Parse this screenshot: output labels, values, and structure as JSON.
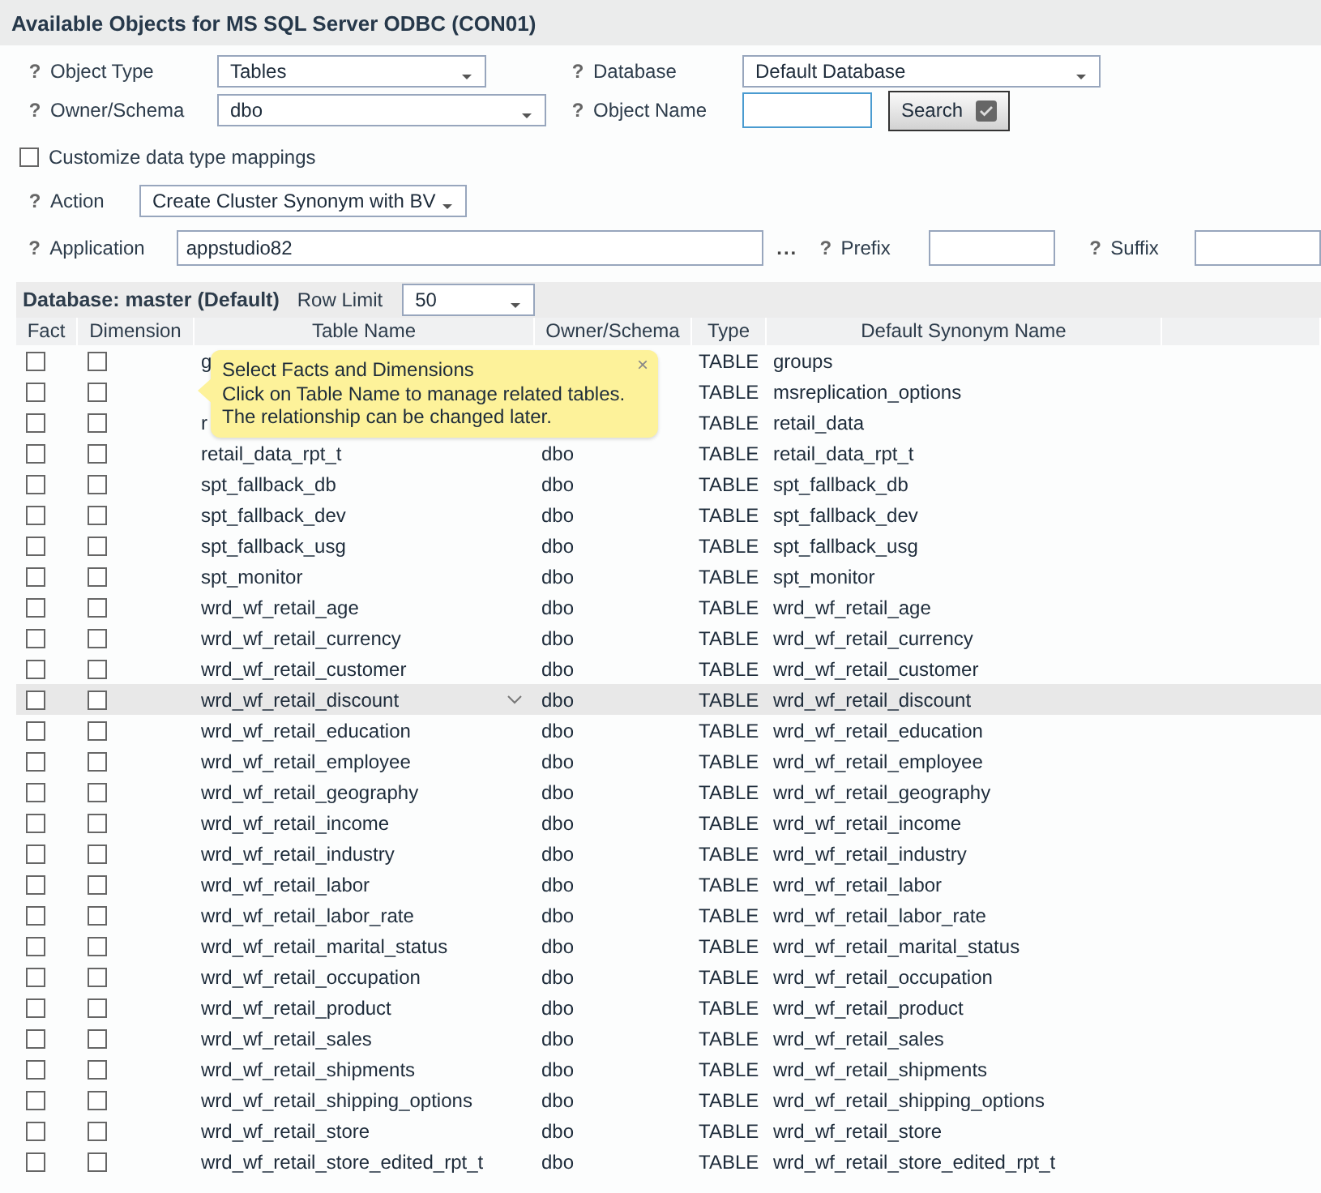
{
  "title": "Available Objects for MS SQL Server ODBC (CON01)",
  "form": {
    "object_type": {
      "help": "?",
      "label": "Object Type",
      "value": "Tables"
    },
    "database": {
      "help": "?",
      "label": "Database",
      "value": "Default Database"
    },
    "owner_schema": {
      "help": "?",
      "label": "Owner/Schema",
      "value": "dbo"
    },
    "object_name": {
      "help": "?",
      "label": "Object Name"
    },
    "search_button": "Search",
    "customize": {
      "label": "Customize data type mappings",
      "checked": false
    },
    "action": {
      "help": "?",
      "label": "Action",
      "value": "Create Cluster Synonym with BV"
    },
    "application": {
      "help": "?",
      "label": "Application",
      "value": "appstudio82",
      "browse": "..."
    },
    "prefix": {
      "help": "?",
      "label": "Prefix"
    },
    "suffix": {
      "help": "?",
      "label": "Suffix"
    }
  },
  "table": {
    "database_label": "Database: master (Default)",
    "row_limit": {
      "label": "Row Limit",
      "value": "50"
    },
    "columns": [
      "Fact",
      "Dimension",
      "Table Name",
      "Owner/Schema",
      "Type",
      "Default Synonym Name"
    ],
    "tooltip": {
      "lines": [
        "Select Facts and Dimensions",
        "Click on Table Name to manage related tables.",
        "The relationship can be changed later."
      ],
      "close": "×"
    },
    "rows": [
      {
        "fact": false,
        "dimension": false,
        "table_name": "g",
        "type": "TABLE",
        "synonym": "groups",
        "hovered": false
      },
      {
        "fact": false,
        "dimension": false,
        "type": "TABLE",
        "synonym": "msreplication_options",
        "hovered": false
      },
      {
        "fact": false,
        "dimension": false,
        "table_name": "r",
        "type": "TABLE",
        "synonym": "retail_data",
        "hovered": false
      },
      {
        "fact": false,
        "dimension": false,
        "table_name": "retail_data_rpt_t",
        "owner": "dbo",
        "type": "TABLE",
        "synonym": "retail_data_rpt_t",
        "hovered": false
      },
      {
        "fact": false,
        "dimension": false,
        "table_name": "spt_fallback_db",
        "owner": "dbo",
        "type": "TABLE",
        "synonym": "spt_fallback_db",
        "hovered": false
      },
      {
        "fact": false,
        "dimension": false,
        "table_name": "spt_fallback_dev",
        "owner": "dbo",
        "type": "TABLE",
        "synonym": "spt_fallback_dev",
        "hovered": false
      },
      {
        "fact": false,
        "dimension": false,
        "table_name": "spt_fallback_usg",
        "owner": "dbo",
        "type": "TABLE",
        "synonym": "spt_fallback_usg",
        "hovered": false
      },
      {
        "fact": false,
        "dimension": false,
        "table_name": "spt_monitor",
        "owner": "dbo",
        "type": "TABLE",
        "synonym": "spt_monitor",
        "hovered": false
      },
      {
        "fact": false,
        "dimension": false,
        "table_name": "wrd_wf_retail_age",
        "owner": "dbo",
        "type": "TABLE",
        "synonym": "wrd_wf_retail_age",
        "hovered": false
      },
      {
        "fact": false,
        "dimension": false,
        "table_name": "wrd_wf_retail_currency",
        "owner": "dbo",
        "type": "TABLE",
        "synonym": "wrd_wf_retail_currency",
        "hovered": false
      },
      {
        "fact": false,
        "dimension": false,
        "table_name": "wrd_wf_retail_customer",
        "owner": "dbo",
        "type": "TABLE",
        "synonym": "wrd_wf_retail_customer",
        "hovered": false
      },
      {
        "fact": false,
        "dimension": false,
        "table_name": "wrd_wf_retail_discount",
        "owner": "dbo",
        "type": "TABLE",
        "synonym": "wrd_wf_retail_discount",
        "hovered": true
      },
      {
        "fact": false,
        "dimension": false,
        "table_name": "wrd_wf_retail_education",
        "owner": "dbo",
        "type": "TABLE",
        "synonym": "wrd_wf_retail_education",
        "hovered": false
      },
      {
        "fact": false,
        "dimension": false,
        "table_name": "wrd_wf_retail_employee",
        "owner": "dbo",
        "type": "TABLE",
        "synonym": "wrd_wf_retail_employee",
        "hovered": false
      },
      {
        "fact": false,
        "dimension": false,
        "table_name": "wrd_wf_retail_geography",
        "owner": "dbo",
        "type": "TABLE",
        "synonym": "wrd_wf_retail_geography",
        "hovered": false
      },
      {
        "fact": false,
        "dimension": false,
        "table_name": "wrd_wf_retail_income",
        "owner": "dbo",
        "type": "TABLE",
        "synonym": "wrd_wf_retail_income",
        "hovered": false
      },
      {
        "fact": false,
        "dimension": false,
        "table_name": "wrd_wf_retail_industry",
        "owner": "dbo",
        "type": "TABLE",
        "synonym": "wrd_wf_retail_industry",
        "hovered": false
      },
      {
        "fact": false,
        "dimension": false,
        "table_name": "wrd_wf_retail_labor",
        "owner": "dbo",
        "type": "TABLE",
        "synonym": "wrd_wf_retail_labor",
        "hovered": false
      },
      {
        "fact": false,
        "dimension": false,
        "table_name": "wrd_wf_retail_labor_rate",
        "owner": "dbo",
        "type": "TABLE",
        "synonym": "wrd_wf_retail_labor_rate",
        "hovered": false
      },
      {
        "fact": false,
        "dimension": false,
        "table_name": "wrd_wf_retail_marital_status",
        "owner": "dbo",
        "type": "TABLE",
        "synonym": "wrd_wf_retail_marital_status",
        "hovered": false
      },
      {
        "fact": false,
        "dimension": false,
        "table_name": "wrd_wf_retail_occupation",
        "owner": "dbo",
        "type": "TABLE",
        "synonym": "wrd_wf_retail_occupation",
        "hovered": false
      },
      {
        "fact": false,
        "dimension": false,
        "table_name": "wrd_wf_retail_product",
        "owner": "dbo",
        "type": "TABLE",
        "synonym": "wrd_wf_retail_product",
        "hovered": false
      },
      {
        "fact": false,
        "dimension": false,
        "table_name": "wrd_wf_retail_sales",
        "owner": "dbo",
        "type": "TABLE",
        "synonym": "wrd_wf_retail_sales",
        "hovered": false
      },
      {
        "fact": false,
        "dimension": false,
        "table_name": "wrd_wf_retail_shipments",
        "owner": "dbo",
        "type": "TABLE",
        "synonym": "wrd_wf_retail_shipments",
        "hovered": false
      },
      {
        "fact": false,
        "dimension": false,
        "table_name": "wrd_wf_retail_shipping_options",
        "owner": "dbo",
        "type": "TABLE",
        "synonym": "wrd_wf_retail_shipping_options",
        "hovered": false
      },
      {
        "fact": false,
        "dimension": false,
        "table_name": "wrd_wf_retail_store",
        "owner": "dbo",
        "type": "TABLE",
        "synonym": "wrd_wf_retail_store",
        "hovered": false
      },
      {
        "fact": false,
        "dimension": false,
        "table_name": "wrd_wf_retail_store_edited_rpt_t",
        "owner": "dbo",
        "type": "TABLE",
        "synonym": "wrd_wf_retail_store_edited_rpt_t",
        "hovered": false
      }
    ]
  }
}
